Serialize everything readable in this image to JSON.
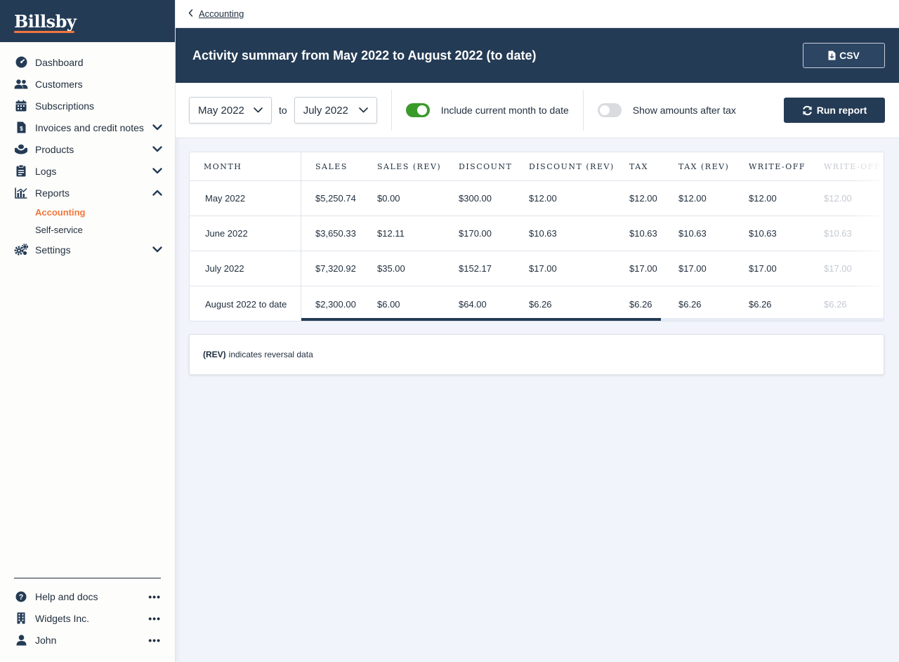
{
  "brand": {
    "name": "Billsby"
  },
  "sidebar": {
    "items": [
      {
        "label": "Dashboard",
        "icon": "dashboard-icon"
      },
      {
        "label": "Customers",
        "icon": "users-icon"
      },
      {
        "label": "Subscriptions",
        "icon": "calendar-icon"
      },
      {
        "label": "Invoices and credit notes",
        "icon": "invoice-icon",
        "expand": "chevron-down-icon"
      },
      {
        "label": "Products",
        "icon": "products-icon",
        "expand": "chevron-down-icon"
      },
      {
        "label": "Logs",
        "icon": "clipboard-icon",
        "expand": "chevron-down-icon"
      },
      {
        "label": "Reports",
        "icon": "chart-icon",
        "expand": "chevron-up-icon"
      },
      {
        "label": "Settings",
        "icon": "gears-icon",
        "expand": "chevron-down-icon"
      }
    ],
    "reports_sub": [
      {
        "label": "Accounting",
        "active": true
      },
      {
        "label": "Self-service",
        "active": false
      }
    ],
    "bottom": [
      {
        "label": "Help and docs",
        "icon": "help-icon",
        "more": "•••"
      },
      {
        "label": "Widgets Inc.",
        "icon": "building-icon",
        "more": "•••"
      },
      {
        "label": "John",
        "icon": "user-icon",
        "more": "•••"
      }
    ]
  },
  "breadcrumb": {
    "back_label": "Accounting"
  },
  "header": {
    "title": "Activity summary from May 2022 to August 2022 (to date)",
    "csv_label": "CSV"
  },
  "filters": {
    "from": "May 2022",
    "to_label": "to",
    "to": "July 2022",
    "include_current_label": "Include current month to date",
    "include_current_on": true,
    "after_tax_label": "Show amounts after tax",
    "after_tax_on": false,
    "run_label": "Run report"
  },
  "table": {
    "month_header": "MONTH",
    "columns": [
      "SALES",
      "SALES (REV)",
      "DISCOUNT",
      "DISCOUNT (REV)",
      "TAX",
      "TAX (REV)",
      "WRITE-OFF",
      "WRITE-OFF"
    ],
    "rows": [
      {
        "month": "May 2022",
        "values": [
          "$5,250.74",
          "$0.00",
          "$300.00",
          "$12.00",
          "$12.00",
          "$12.00",
          "$12.00",
          "$12.00"
        ]
      },
      {
        "month": "June 2022",
        "values": [
          "$3,650.33",
          "$12.11",
          "$170.00",
          "$10.63",
          "$10.63",
          "$10.63",
          "$10.63",
          "$10.63"
        ]
      },
      {
        "month": "July 2022",
        "values": [
          "$7,320.92",
          "$35.00",
          "$152.17",
          "$17.00",
          "$17.00",
          "$17.00",
          "$17.00",
          "$17.00"
        ]
      },
      {
        "month": "August 2022 to date",
        "values": [
          "$2,300.00",
          "$6.00",
          "$64.00",
          "$6.26",
          "$6.26",
          "$6.26",
          "$6.26",
          "$6.26"
        ]
      }
    ]
  },
  "note": {
    "bold": "(REV)",
    "text": "indicates reversal data"
  },
  "colors": {
    "navy": "#243b55",
    "accent": "#f2763d",
    "toggle_on": "#3a9b2b"
  }
}
